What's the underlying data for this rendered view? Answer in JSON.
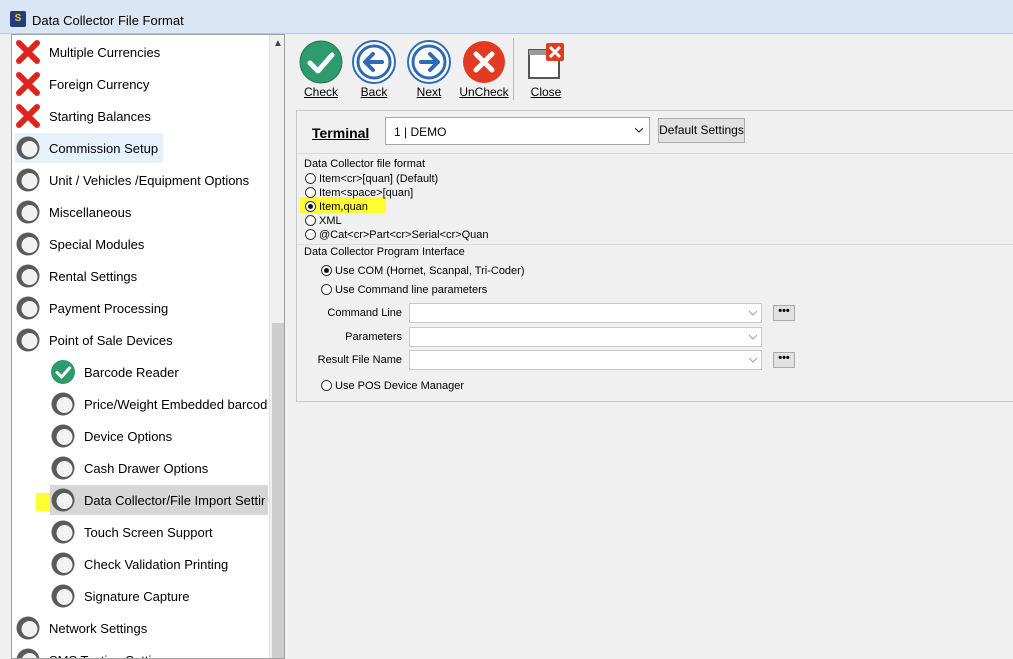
{
  "window": {
    "title": "Data Collector File Format"
  },
  "tree": {
    "items": [
      {
        "label": "Multiple Currencies",
        "icon": "red-x-icon"
      },
      {
        "label": "Foreign Currency",
        "icon": "red-x-icon"
      },
      {
        "label": "Starting Balances",
        "icon": "red-x-icon"
      },
      {
        "label": "Commission Setup",
        "icon": "gray-circle-icon"
      },
      {
        "label": "Unit / Vehicles /Equipment Options",
        "icon": "gray-circle-icon"
      },
      {
        "label": "Miscellaneous",
        "icon": "gray-circle-icon"
      },
      {
        "label": "Special Modules",
        "icon": "gray-circle-icon"
      },
      {
        "label": "Rental Settings",
        "icon": "gray-circle-icon"
      },
      {
        "label": "Payment Processing",
        "icon": "gray-circle-icon"
      },
      {
        "label": "Point of Sale Devices",
        "icon": "gray-circle-icon"
      },
      {
        "label": "Barcode Reader",
        "icon": "green-check-icon"
      },
      {
        "label": "Price/Weight Embedded barcod",
        "icon": "gray-circle-icon"
      },
      {
        "label": "Device Options",
        "icon": "gray-circle-icon"
      },
      {
        "label": "Cash Drawer Options",
        "icon": "gray-circle-icon"
      },
      {
        "label": "Data Collector/File Import Settir",
        "icon": "gray-circle-icon"
      },
      {
        "label": "Touch Screen Support",
        "icon": "gray-circle-icon"
      },
      {
        "label": "Check Validation Printing",
        "icon": "gray-circle-icon"
      },
      {
        "label": "Signature Capture",
        "icon": "gray-circle-icon"
      },
      {
        "label": "Network Settings",
        "icon": "gray-circle-icon"
      },
      {
        "label": "SMS Texting Settings",
        "icon": "gray-circle-icon"
      }
    ]
  },
  "toolbar": {
    "check": "Check",
    "back": "Back",
    "next": "Next",
    "uncheck": "UnCheck",
    "close": "Close"
  },
  "terminal": {
    "label": "Terminal",
    "value": "1 | DEMO",
    "default_button": "Default Settings"
  },
  "file_format": {
    "title": "Data Collector file format",
    "options": [
      {
        "label": "Item<cr>[quan]  (Default)",
        "checked": false
      },
      {
        "label": "Item<space>[quan]",
        "checked": false
      },
      {
        "label": "Item,quan",
        "checked": true
      },
      {
        "label": "XML",
        "checked": false
      },
      {
        "label": "@Cat<cr>Part<cr>Serial<cr>Quan",
        "checked": false
      }
    ]
  },
  "program_interface": {
    "title": "Data Collector Program Interface",
    "use_com": "Use COM (Hornet, Scanpal, Tri-Coder)",
    "use_cmd": "Use Command line parameters",
    "command_line": "Command Line",
    "parameters": "Parameters",
    "result_file": "Result File Name",
    "use_pos": "Use POS Device Manager",
    "dots": "•••"
  }
}
